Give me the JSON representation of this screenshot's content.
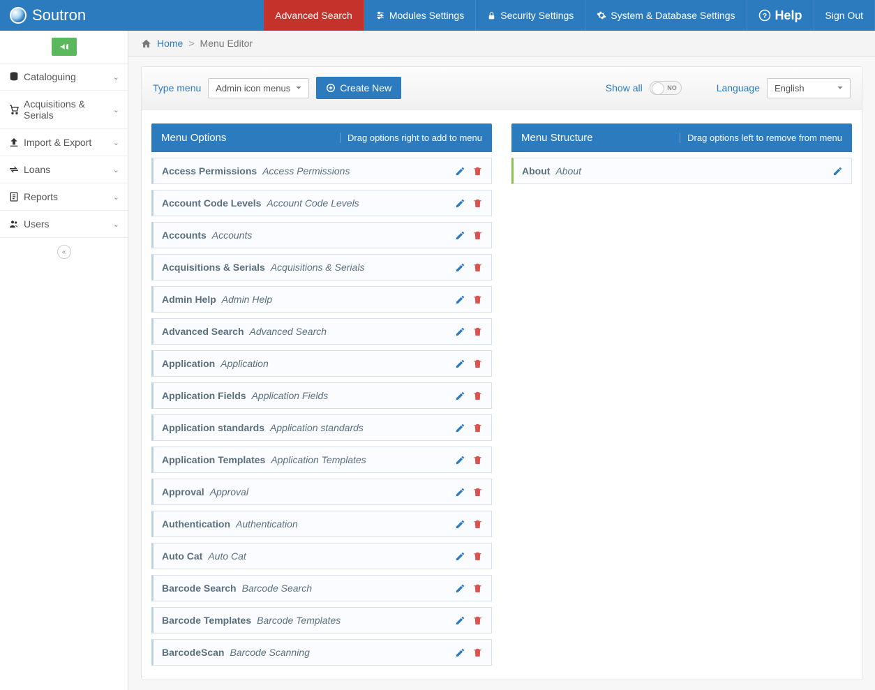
{
  "brand": "Soutron",
  "topnav": {
    "advanced_search": "Advanced Search",
    "modules_settings": "Modules Settings",
    "security_settings": "Security Settings",
    "system_db_settings": "System & Database Settings",
    "help": "Help",
    "sign_out": "Sign Out"
  },
  "sidebar": {
    "items": [
      {
        "label": "Cataloguing"
      },
      {
        "label": "Acquisitions & Serials"
      },
      {
        "label": "Import & Export"
      },
      {
        "label": "Loans"
      },
      {
        "label": "Reports"
      },
      {
        "label": "Users"
      }
    ]
  },
  "breadcrumb": {
    "home": "Home",
    "current": "Menu Editor"
  },
  "toolbar": {
    "type_menu_label": "Type menu",
    "type_menu_value": "Admin icon menus",
    "create_new": "Create New",
    "show_all": "Show all",
    "toggle_state": "NO",
    "language_label": "Language",
    "language_value": "English"
  },
  "columns": {
    "options": {
      "title": "Menu Options",
      "hint": "Drag options right to add to menu",
      "items": [
        {
          "key": "Access Permissions",
          "val": "Access Permissions"
        },
        {
          "key": "Account Code Levels",
          "val": "Account Code Levels"
        },
        {
          "key": "Accounts",
          "val": "Accounts"
        },
        {
          "key": "Acquisitions & Serials",
          "val": "Acquisitions & Serials"
        },
        {
          "key": "Admin Help",
          "val": "Admin Help"
        },
        {
          "key": "Advanced Search",
          "val": "Advanced Search"
        },
        {
          "key": "Application",
          "val": "Application"
        },
        {
          "key": "Application Fields",
          "val": "Application Fields"
        },
        {
          "key": "Application standards",
          "val": "Application standards"
        },
        {
          "key": "Application Templates",
          "val": "Application Templates"
        },
        {
          "key": "Approval",
          "val": "Approval"
        },
        {
          "key": "Authentication",
          "val": "Authentication"
        },
        {
          "key": "Auto Cat",
          "val": "Auto Cat"
        },
        {
          "key": "Barcode Search",
          "val": "Barcode Search"
        },
        {
          "key": "Barcode Templates",
          "val": "Barcode Templates"
        },
        {
          "key": "BarcodeScan",
          "val": "Barcode Scanning"
        }
      ]
    },
    "structure": {
      "title": "Menu Structure",
      "hint": "Drag options left to remove from menu",
      "items": [
        {
          "key": "About",
          "val": "About"
        }
      ]
    }
  }
}
